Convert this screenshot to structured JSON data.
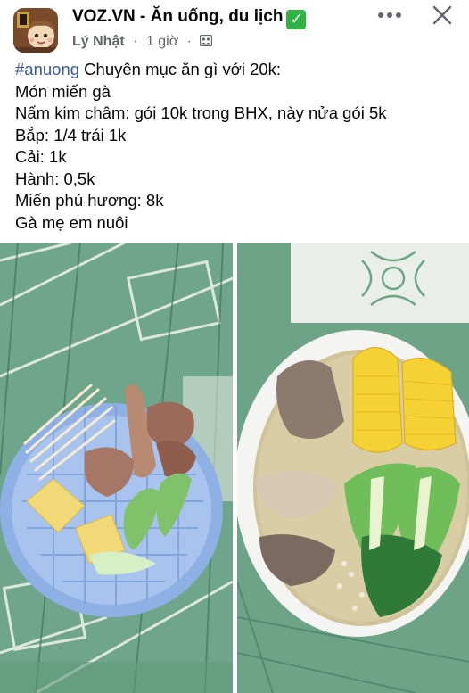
{
  "header": {
    "group_name": "VOZ.VN - Ăn uống, du lịch",
    "verified_mark": "✓",
    "author": "Lý Nhật",
    "time": "1 giờ",
    "separator": "·"
  },
  "post": {
    "hashtag": "#anuong",
    "lines": [
      " Chuyên mục ăn gì với 20k:",
      "Món miến gà",
      "Nấm kim châm: gói 10k trong BHX, này nửa gói 5k",
      "Bắp: 1/4 trái 1k",
      "Cải: 1k",
      "Hành: 0,5k",
      "Miến phú hương: 8k",
      "Gà mẹ em nuôi"
    ]
  },
  "icons": {
    "avatar": "group-avatar",
    "privacy": "group-members-icon",
    "more": "more-options-icon",
    "close": "close-icon"
  },
  "colors": {
    "hashtag": "#385898",
    "meta": "#65676b",
    "verified": "#2fb344",
    "tile_green": "#5f9a7c"
  }
}
